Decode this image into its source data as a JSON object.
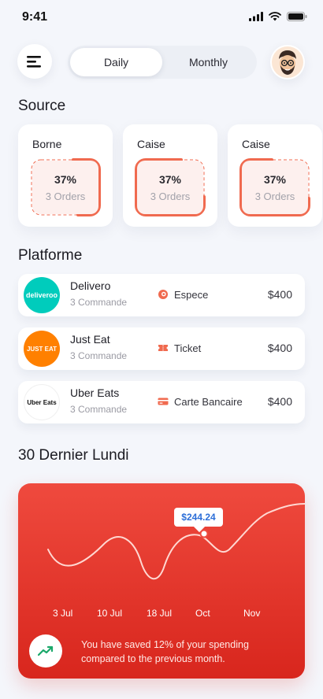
{
  "status_bar": {
    "time": "9:41"
  },
  "header": {
    "tabs": [
      {
        "label": "Daily",
        "active": true
      },
      {
        "label": "Monthly",
        "active": false
      }
    ]
  },
  "source": {
    "title": "Source",
    "cards": [
      {
        "label": "Borne",
        "percent": "37%",
        "orders": "3 Orders"
      },
      {
        "label": "Caise",
        "percent": "37%",
        "orders": "3 Orders"
      },
      {
        "label": "Caise",
        "percent": "37%",
        "orders": "3 Orders"
      }
    ]
  },
  "platforme": {
    "title": "Platforme",
    "rows": [
      {
        "name": "Delivero",
        "logo_text": "deliveroo",
        "logo_color": "#00ccbc",
        "count": "3 Commande",
        "payment": "Espece",
        "payment_icon": "coin-icon",
        "amount": "$400"
      },
      {
        "name": "Just Eat",
        "logo_text": "JUST EAT",
        "logo_color": "#ff8000",
        "count": "3 Commande",
        "payment": "Ticket",
        "payment_icon": "ticket-icon",
        "amount": "$400"
      },
      {
        "name": "Uber Eats",
        "logo_text": "Uber Eats",
        "logo_color": "#ffffff",
        "count": "3 Commande",
        "payment": "Carte Bancaire",
        "payment_icon": "card-icon",
        "amount": "$400"
      }
    ]
  },
  "lundi": {
    "title": "30 Dernier Lundi",
    "tooltip": "$244.24",
    "x_ticks": [
      "3 Jul",
      "10 Jul",
      "18 Jul",
      "Oct",
      "Nov"
    ],
    "saved_text": "You have saved 12% of your spending compared to the previous month."
  },
  "colors": {
    "accent": "#f06a4f",
    "chart_top": "#ef4a3e",
    "chart_bottom": "#d8261d",
    "tooltip_text": "#2d6fd8"
  }
}
